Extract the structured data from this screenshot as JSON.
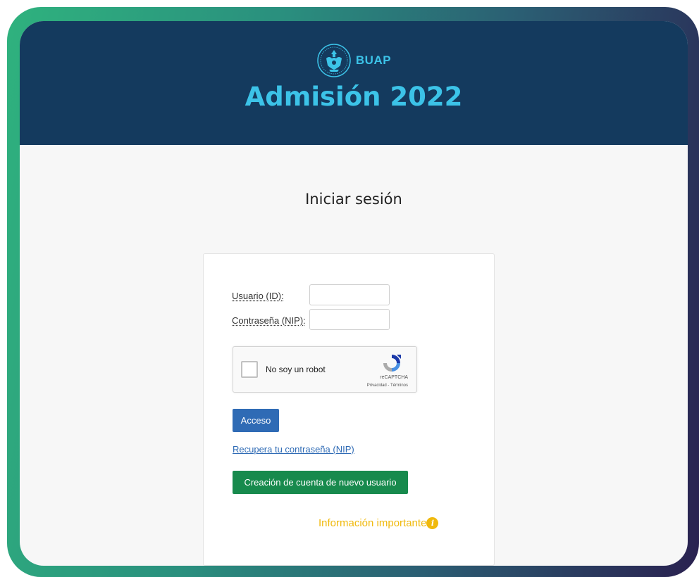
{
  "header": {
    "brand_name": "BUAP",
    "app_title": "Admisión 2022",
    "seal_icon": "university-seal-icon"
  },
  "login": {
    "heading": "Iniciar sesión",
    "user_label": "Usuario (ID):",
    "user_value": "",
    "password_label": "Contraseña (NIP):",
    "password_value": "",
    "captcha": {
      "text": "No soy un robot",
      "brand": "reCAPTCHA",
      "links": "Privacidad - Términos",
      "checked": false
    },
    "access_button": "Acceso",
    "recover_link": "Recupera tu contraseña (NIP)",
    "create_account_button": "Creación de cuenta de nuevo usuario",
    "info_link": "Información importante",
    "info_icon_glyph": "i"
  },
  "colors": {
    "header_bg": "#143a5e",
    "title_color": "#3cc3e8",
    "access_button": "#2f6bb5",
    "create_button": "#178a4d",
    "info_color": "#f0b90c",
    "frame_start": "#2fb27e",
    "frame_end": "#2a2150"
  }
}
